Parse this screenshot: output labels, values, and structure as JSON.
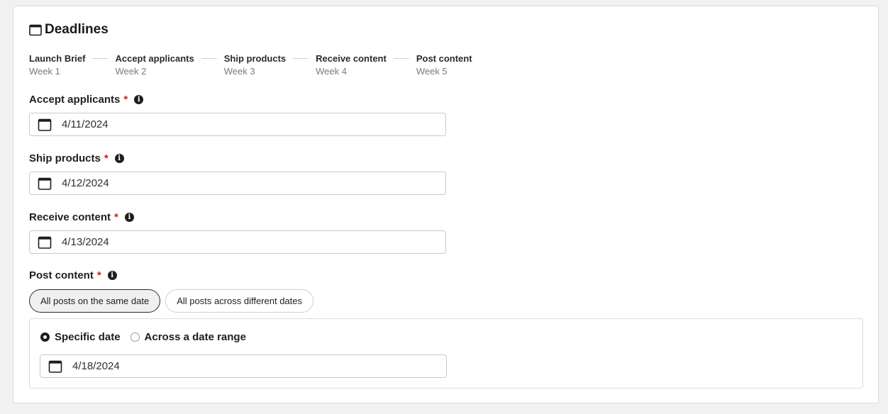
{
  "section": {
    "title": "Deadlines"
  },
  "steps": [
    {
      "name": "Launch Brief",
      "week": "Week 1"
    },
    {
      "name": "Accept applicants",
      "week": "Week 2"
    },
    {
      "name": "Ship products",
      "week": "Week 3"
    },
    {
      "name": "Receive content",
      "week": "Week 4"
    },
    {
      "name": "Post content",
      "week": "Week 5"
    }
  ],
  "fields": {
    "accept": {
      "label": "Accept applicants",
      "required": "*",
      "value": "4/11/2024"
    },
    "ship": {
      "label": "Ship products",
      "required": "*",
      "value": "4/12/2024"
    },
    "receive": {
      "label": "Receive content",
      "required": "*",
      "value": "4/13/2024"
    },
    "post": {
      "label": "Post content",
      "required": "*"
    }
  },
  "post_options": {
    "same_date": "All posts on the same date",
    "different_dates": "All posts across different dates",
    "selected": "same_date"
  },
  "date_mode": {
    "specific": "Specific date",
    "range": "Across a date range",
    "selected": "specific",
    "value": "4/18/2024"
  },
  "icons": {
    "calendar": "calendar-icon",
    "info": "info-icon"
  },
  "colors": {
    "required": "#d21f1f",
    "border": "#c9c9c9"
  }
}
